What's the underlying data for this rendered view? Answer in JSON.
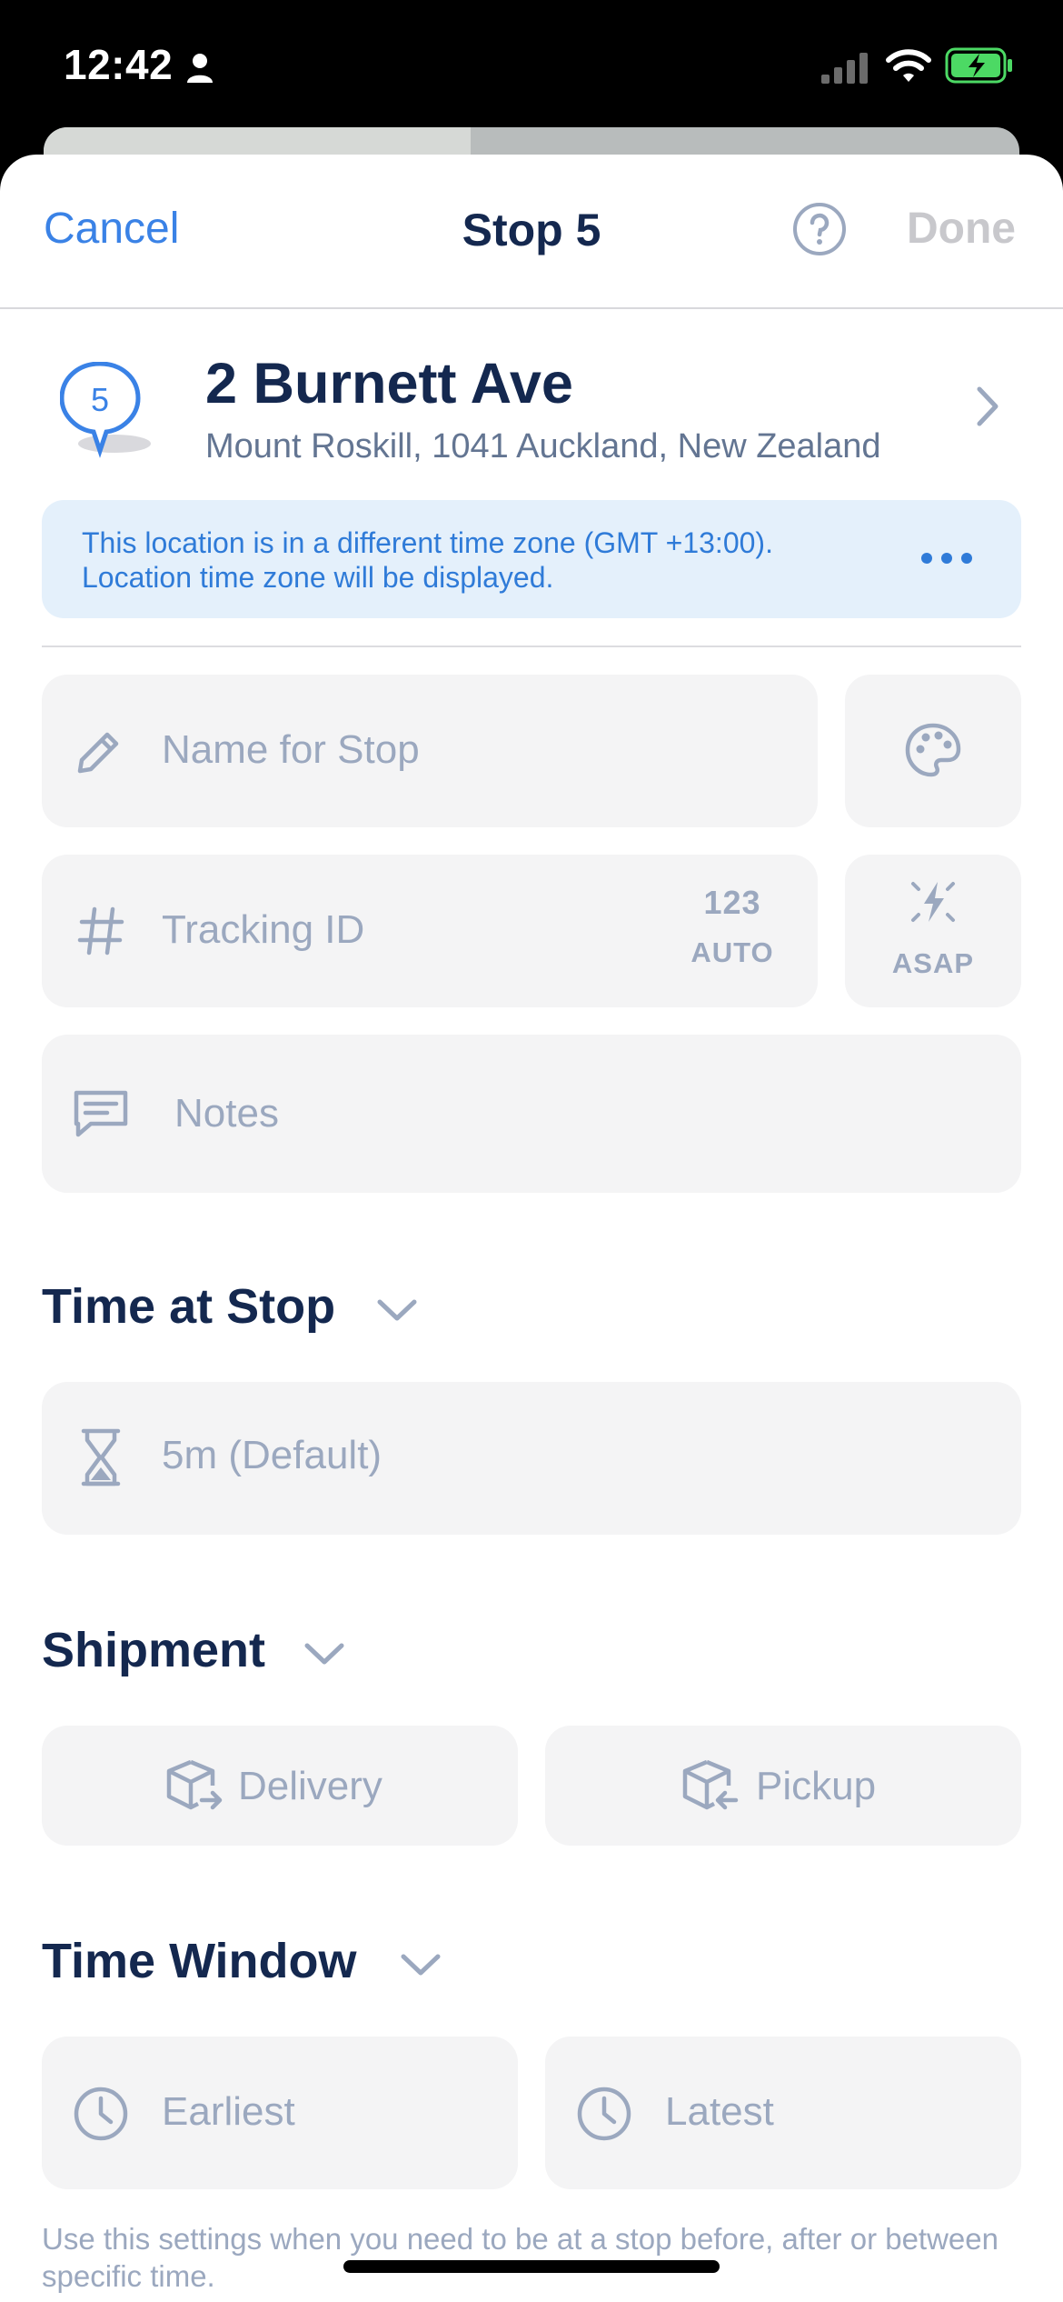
{
  "status_bar": {
    "time": "12:42"
  },
  "nav": {
    "cancel_label": "Cancel",
    "title": "Stop 5",
    "done_label": "Done"
  },
  "stop": {
    "number": "5",
    "address_line1": "2 Burnett Ave",
    "address_line2": "Mount Roskill, 1041 Auckland, New Zealand"
  },
  "timezone_notice": {
    "line1": "This location is in a different time zone (GMT +13:00).",
    "line2": "Location time zone will be displayed."
  },
  "fields": {
    "name_placeholder": "Name for Stop",
    "tracking_placeholder": "Tracking ID",
    "auto_number": "123",
    "auto_label": "AUTO",
    "asap_label": "ASAP",
    "notes_placeholder": "Notes"
  },
  "time_at_stop": {
    "heading": "Time at Stop",
    "value": "5m (Default)"
  },
  "shipment": {
    "heading": "Shipment",
    "delivery_label": "Delivery",
    "pickup_label": "Pickup"
  },
  "time_window": {
    "heading": "Time Window",
    "earliest_label": "Earliest",
    "latest_label": "Latest",
    "help_text": "Use this settings when you need to be at a stop before, after or between specific time."
  },
  "icons": {
    "person": "person-icon",
    "signal": "cellular-signal-icon",
    "wifi": "wifi-icon",
    "battery": "battery-charging-icon",
    "help": "question-circle-icon",
    "pin": "map-pin-icon",
    "chevron": "chevron-right-icon",
    "more": "more-dots-icon",
    "pencil": "pencil-icon",
    "palette": "palette-icon",
    "hash": "hash-icon",
    "flash": "flash-icon",
    "notes": "message-square-icon",
    "hourglass": "hourglass-icon",
    "delivery": "box-out-icon",
    "pickup": "box-in-icon",
    "clock": "clock-icon"
  },
  "colors": {
    "accent": "#3a82e6",
    "title": "#14284f",
    "placeholder": "#9ba8bf",
    "notice_bg": "#e4f0fb",
    "field_bg": "#f4f4f5",
    "battery": "#4cd964"
  }
}
